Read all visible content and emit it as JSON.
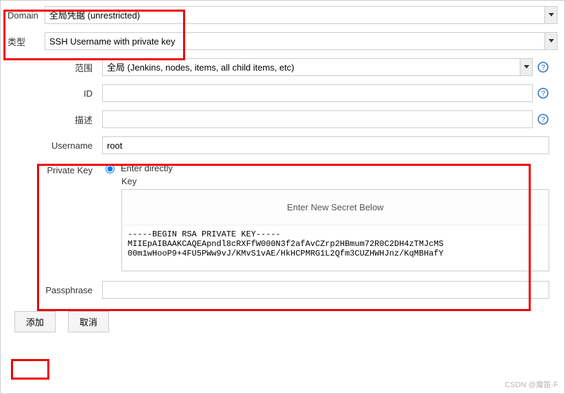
{
  "domain": {
    "label": "Domain",
    "value": "全局凭据 (unrestricted)"
  },
  "type": {
    "label": "类型",
    "value": "SSH Username with private key"
  },
  "scope": {
    "label": "范围",
    "value": "全局 (Jenkins, nodes, items, all child items, etc)"
  },
  "id": {
    "label": "ID",
    "value": ""
  },
  "desc": {
    "label": "描述",
    "value": ""
  },
  "username": {
    "label": "Username",
    "value": "root"
  },
  "privateKey": {
    "label": "Private Key",
    "radioLabel": "Enter directly",
    "keyLabel": "Key",
    "secretHeader": "Enter New Secret Below",
    "secretValue": "-----BEGIN RSA PRIVATE KEY-----\nMIIEpAIBAAKCAQEApndl8cRXFfW000N3f2afAvCZrp2HBmum72R0C2DH4zTMJcMS\n00m1wHooP9+4FU5PWw9vJ/KMvS1vAE/HkHCPMRG1L2Qfm3CUZHWHJnz/KqMBHafY"
  },
  "passphrase": {
    "label": "Passphrase",
    "value": ""
  },
  "buttons": {
    "add": "添加",
    "cancel": "取消"
  },
  "watermark": "CSDN @魔笛-F"
}
